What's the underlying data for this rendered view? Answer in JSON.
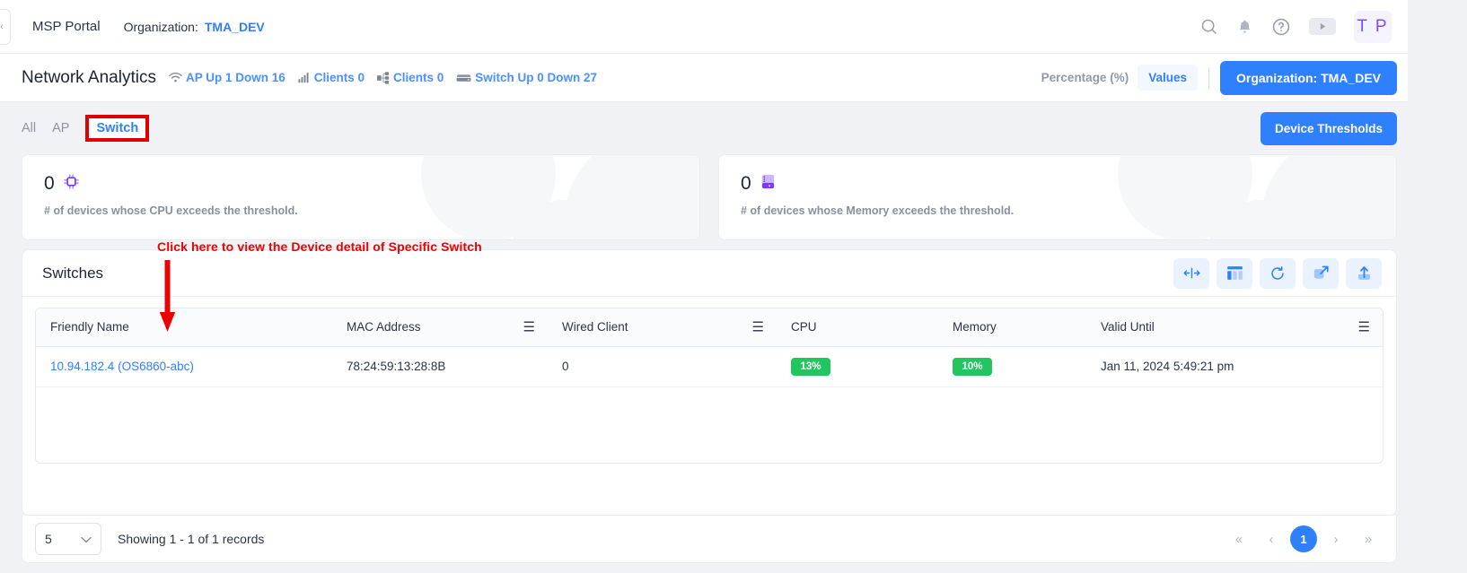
{
  "topbar": {
    "brand": "MSP Portal",
    "org_label": "Organization:",
    "org_value": "TMA_DEV",
    "avatar_initials": "T P",
    "icons": {
      "search": "search-icon",
      "bell": "bell-icon",
      "help": "help-circle-icon",
      "video": "video-play-icon"
    }
  },
  "header": {
    "title": "Network Analytics",
    "stats": [
      {
        "icon": "wifi-icon",
        "text": "AP  Up 1  Down 16"
      },
      {
        "icon": "signal-bars-icon",
        "text": "Clients 0"
      },
      {
        "icon": "network-topology-icon",
        "text": "Clients 0"
      },
      {
        "icon": "switch-icon",
        "text": "Switch Up 0  Down 27"
      }
    ],
    "toggle_percentage": "Percentage (%)",
    "toggle_values": "Values",
    "org_button": "Organization: TMA_DEV"
  },
  "tabs": [
    {
      "label": "All",
      "active": false
    },
    {
      "label": "AP",
      "active": false
    },
    {
      "label": "Switch",
      "active": true
    }
  ],
  "thresholds_button": "Device Thresholds",
  "kpis": [
    {
      "value": "0",
      "icon": "cpu-chip-icon",
      "description": "# of devices whose CPU exceeds the threshold."
    },
    {
      "value": "0",
      "icon": "memory-module-icon",
      "description": "# of devices whose Memory exceeds the threshold."
    }
  ],
  "panel": {
    "title": "Switches",
    "actions": [
      {
        "name": "fit-columns-icon",
        "glyph": "fit-width"
      },
      {
        "name": "columns-chooser-icon",
        "glyph": "columns"
      },
      {
        "name": "refresh-icon",
        "glyph": "refresh"
      },
      {
        "name": "expand-icon",
        "glyph": "expand"
      },
      {
        "name": "export-upload-icon",
        "glyph": "upload"
      }
    ]
  },
  "table": {
    "columns": [
      {
        "label": "Friendly Name",
        "menu": false
      },
      {
        "label": "MAC Address",
        "menu": true
      },
      {
        "label": "Wired Client",
        "menu": true
      },
      {
        "label": "CPU",
        "menu": false
      },
      {
        "label": "Memory",
        "menu": false
      },
      {
        "label": "Valid Until",
        "menu": true
      }
    ],
    "rows": [
      {
        "friendly_name": "10.94.182.4 (OS6860-abc)",
        "mac_address": "78:24:59:13:28:8B",
        "wired_client": "0",
        "cpu": "13%",
        "memory": "10%",
        "valid_until": "Jan 11, 2024 5:49:21 pm"
      }
    ]
  },
  "footer": {
    "page_size": "5",
    "showing": "Showing 1 - 1 of 1 records",
    "pager": {
      "first": "«",
      "prev": "‹",
      "current": "1",
      "next": "›",
      "last": "»"
    }
  },
  "annotation": {
    "text": "Click here to view the Device detail of Specific Switch",
    "color": "#ef0000"
  },
  "colors": {
    "accent_blue": "#2f80ff",
    "status_green": "#22c55e",
    "purple": "#7c4dff",
    "annotation_red": "#ef0000"
  }
}
